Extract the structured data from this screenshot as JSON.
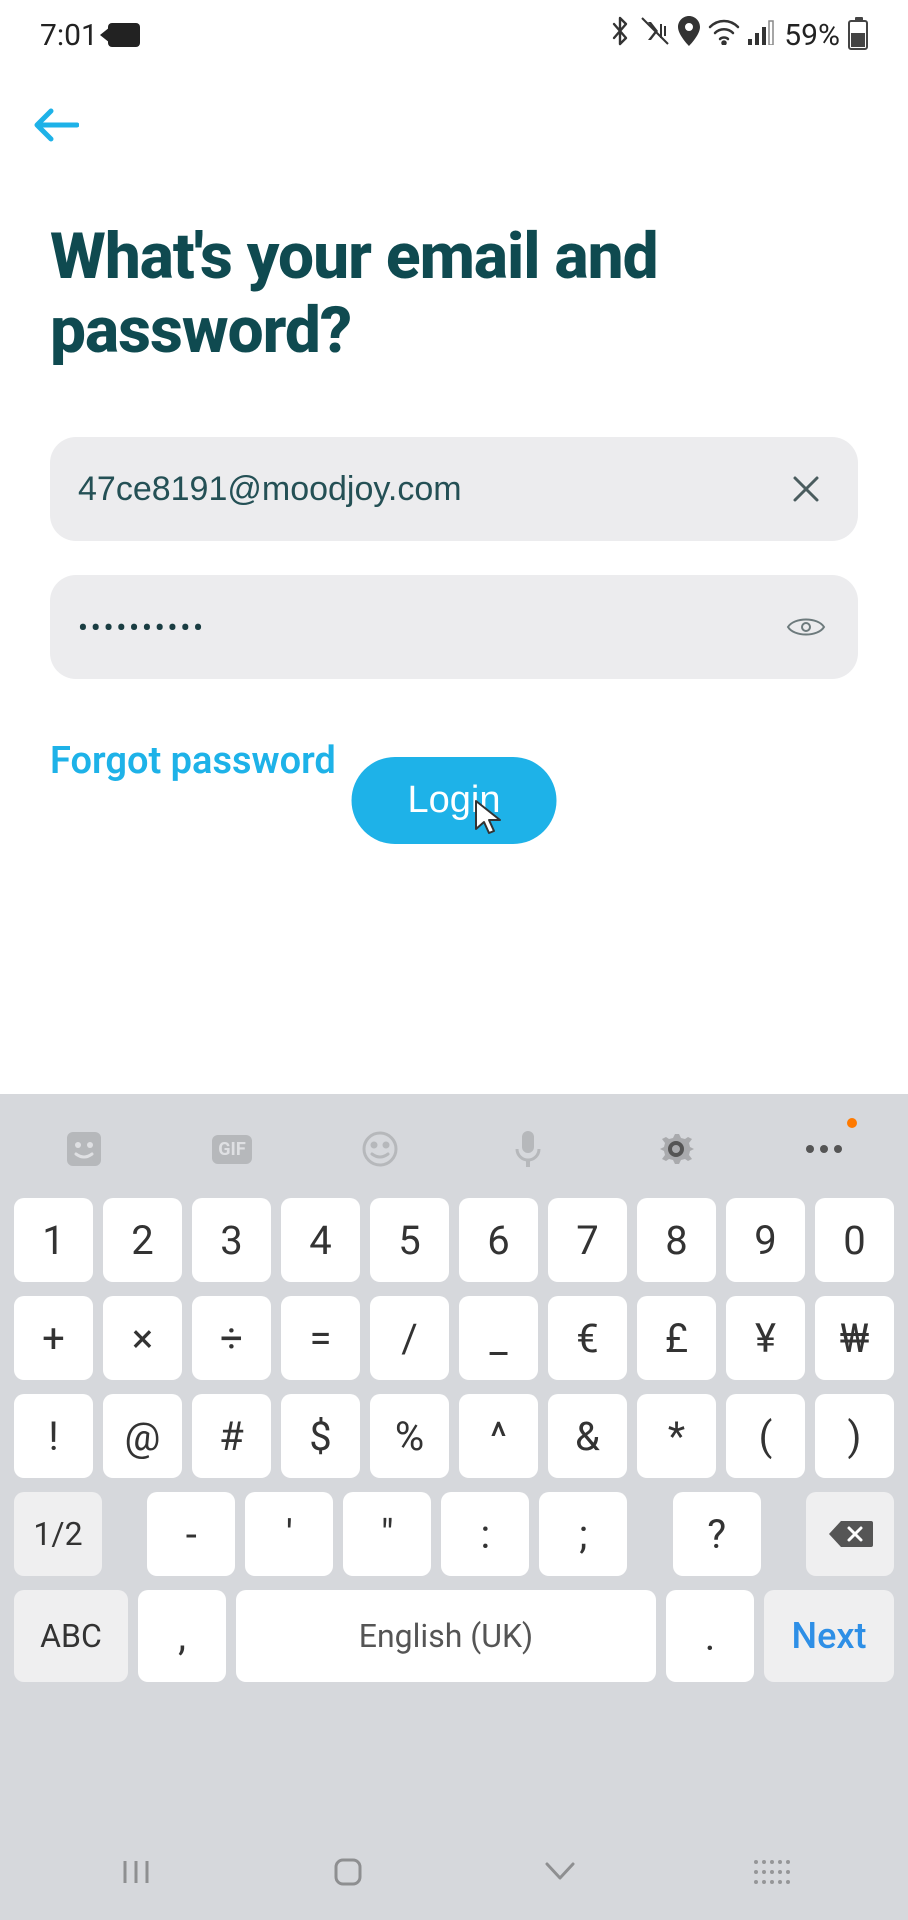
{
  "status_bar": {
    "time": "7:01",
    "battery_pct": "59%"
  },
  "screen": {
    "heading": "What's your email and password?",
    "email": {
      "value": "47ce8191@moodjoy.com"
    },
    "password": {
      "masked": "••••••••••"
    },
    "forgot_label": "Forgot password",
    "login_label": "Login"
  },
  "keyboard": {
    "rows": [
      [
        "1",
        "2",
        "3",
        "4",
        "5",
        "6",
        "7",
        "8",
        "9",
        "0"
      ],
      [
        "+",
        "×",
        "÷",
        "=",
        "/",
        "_",
        "€",
        "£",
        "¥",
        "₩"
      ],
      [
        "!",
        "@",
        "#",
        "$",
        "%",
        "^",
        "&",
        "*",
        "(",
        ")"
      ]
    ],
    "row4": {
      "shift": "1/2",
      "keys": [
        "-",
        "'",
        "\"",
        ":",
        ";",
        "?"
      ]
    },
    "row5": {
      "mode": "ABC",
      "comma": ",",
      "space": "English (UK)",
      "period": ".",
      "action": "Next"
    }
  }
}
